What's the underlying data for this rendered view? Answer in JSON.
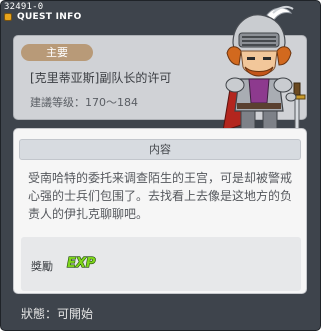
{
  "window": {
    "quest_id": "32491-0",
    "title": "QUEST INFO"
  },
  "quest": {
    "type_tag": "主要",
    "name": "[克里蒂亚斯]副队长的许可",
    "level_requirement": "建議等级：170～184"
  },
  "content": {
    "header": "内容",
    "description": "受南哈特的委托来调查陌生的王宫，可是却被警戒心强的士兵们包围了。去找看上去像是这地方的负责人的伊扎克聊聊吧。"
  },
  "reward": {
    "label": "獎勵",
    "exp_text": "EXP",
    "exp_icon": "exp-icon"
  },
  "status": {
    "text": "狀態：可開始"
  },
  "colors": {
    "window_bg": "#3e444c",
    "panel_bg": "#d0d2d6",
    "tag_bg": "#b89a78",
    "exp_green": "#7fd61c",
    "content_bg": "#f6f6f6"
  }
}
